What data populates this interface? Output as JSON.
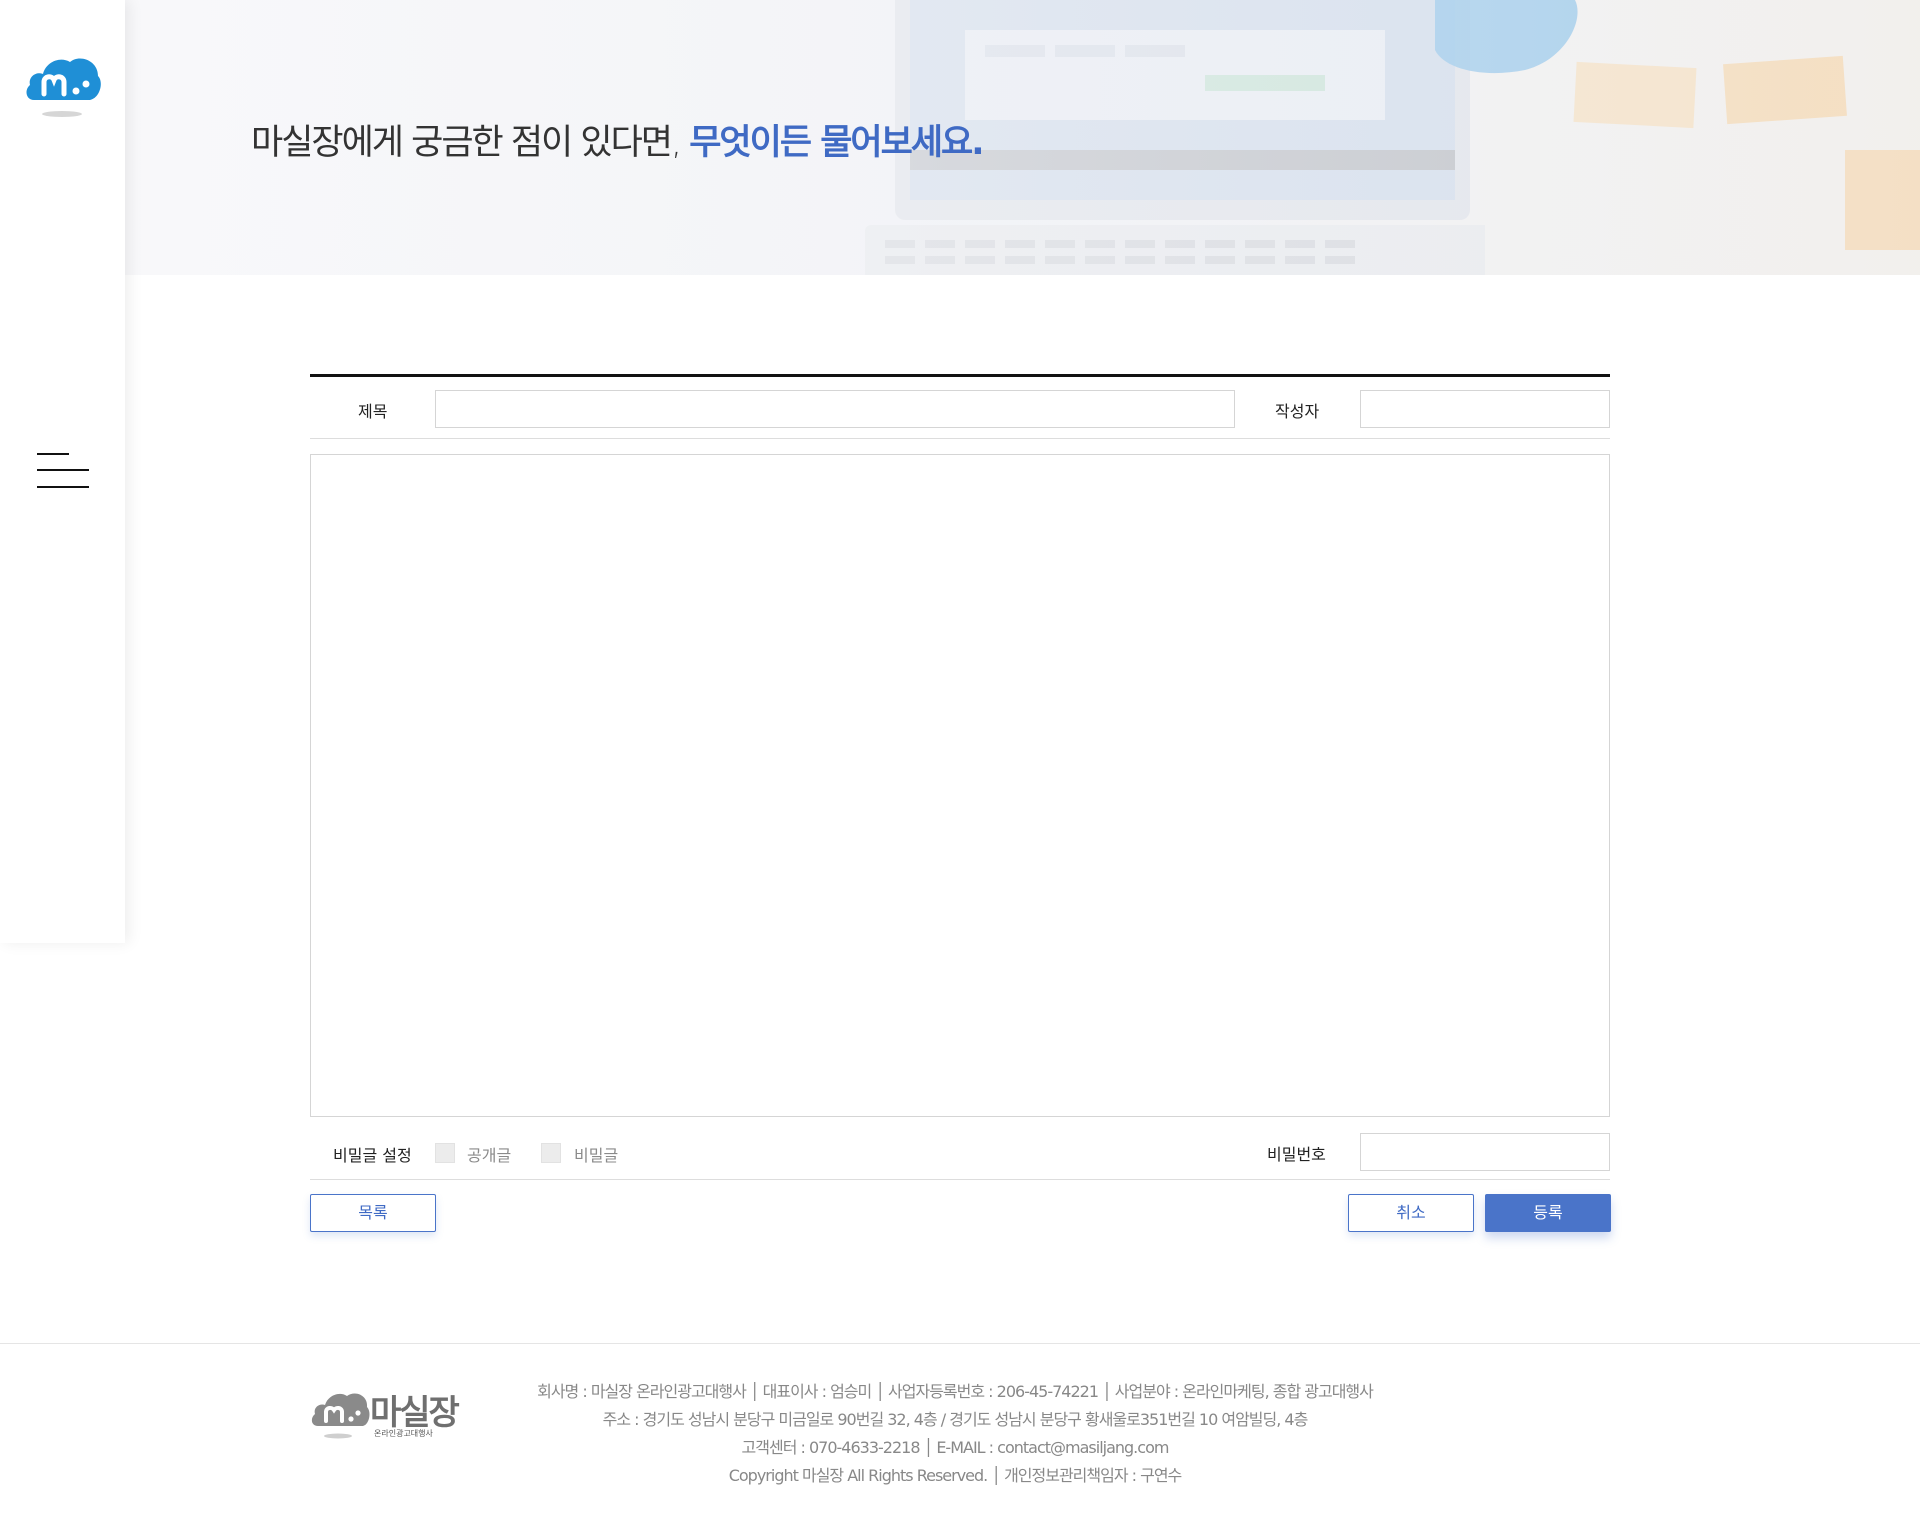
{
  "hero": {
    "title_prefix": "마실장에게 궁금한 점이 있다면, ",
    "title_accent": "무엇이든 물어보세요."
  },
  "form": {
    "title_label": "제목",
    "title_value": "",
    "author_label": "작성자",
    "author_value": "",
    "content_value": "",
    "secret_label": "비밀글 설정",
    "option_public": "공개글",
    "option_secret": "비밀글",
    "password_label": "비밀번호",
    "password_value": ""
  },
  "buttons": {
    "list": "목록",
    "cancel": "취소",
    "submit": "등록"
  },
  "footer": {
    "logo_text": "마실장",
    "logo_subtext": "온라인광고대행사",
    "line1": "회사명 : 마실장 온라인광고대행사 │ 대표이사 : 엄승미 │ 사업자등록번호 : 206-45-74221 │ 사업분야 : 온라인마케팅, 종합 광고대행사",
    "line2": "주소 : 경기도 성남시 분당구 미금일로 90번길 32, 4층 / 경기도 성남시 분당구 황새울로351번길 10 여암빌딩, 4층",
    "line3": "고객센터 : 070-4633-2218 │ E-MAIL : contact@masiljang.com",
    "line4": "Copyright 마실장 All Rights Reserved. │ 개인정보관리책임자 : 구연수"
  },
  "colors": {
    "accent": "#3f6ac4",
    "button_fill": "#4a74c9",
    "logo_blue": "#1f8fd6"
  },
  "icons": {
    "logo": "cloud-m-logo-icon",
    "menu": "hamburger-menu-icon"
  }
}
